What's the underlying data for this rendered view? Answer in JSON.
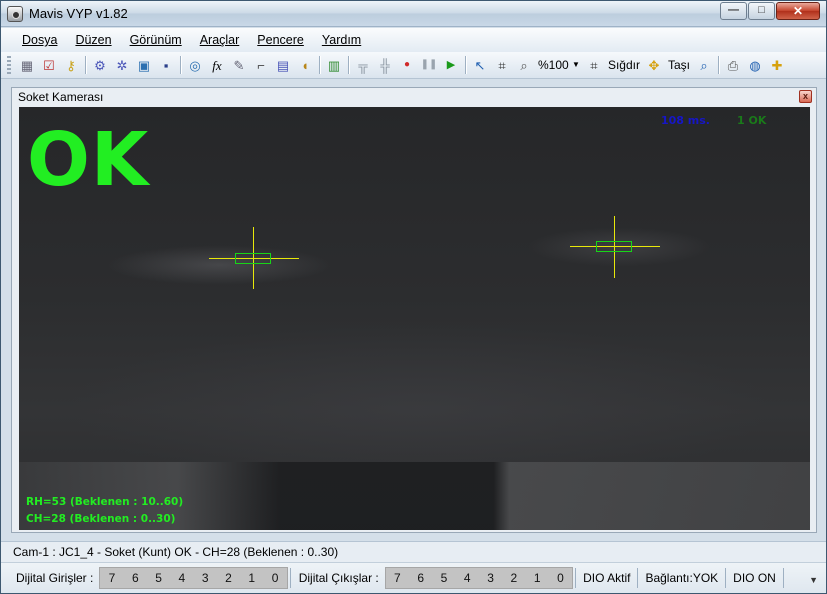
{
  "window": {
    "title": "Mavis VYP v1.82",
    "controls": {
      "minimize": "—",
      "maximize": "□",
      "close": "✕"
    }
  },
  "menu": [
    {
      "label": "Dosya"
    },
    {
      "label": "Düzen"
    },
    {
      "label": "Görünüm"
    },
    {
      "label": "Araçlar"
    },
    {
      "label": "Pencere"
    },
    {
      "label": "Yardım"
    }
  ],
  "toolbar": {
    "zoom_label": "%100",
    "fit_label": "Sığdır",
    "move_label": "Taşı"
  },
  "child_window": {
    "title": "Soket Kamerası",
    "close": "x"
  },
  "camera": {
    "status": "OK",
    "time_ms": "108 ms.",
    "ok_count": "1 OK",
    "rh_line": "RH=53 (Beklenen : 10..60)",
    "ch_line": "CH=28 (Beklenen : 0..30)"
  },
  "status": {
    "message": "Cam-1 : JC1_4 - Soket (Kunt) OK - CH=28 (Beklenen : 0..30)"
  },
  "io": {
    "inputs_label": "Dijital Girişler :",
    "input_bits": [
      "7",
      "6",
      "5",
      "4",
      "3",
      "2",
      "1",
      "0"
    ],
    "outputs_label": "Dijital Çıkışlar :",
    "output_bits": [
      "7",
      "6",
      "5",
      "4",
      "3",
      "2",
      "1",
      "0"
    ],
    "dio_active": "DIO Aktif",
    "connection": "Bağlantı:YOK",
    "dio_on": "DIO ON"
  },
  "colors": {
    "ok_green": "#22ee22",
    "crosshair": "#e8e80a",
    "time_blue": "#1616c8"
  }
}
